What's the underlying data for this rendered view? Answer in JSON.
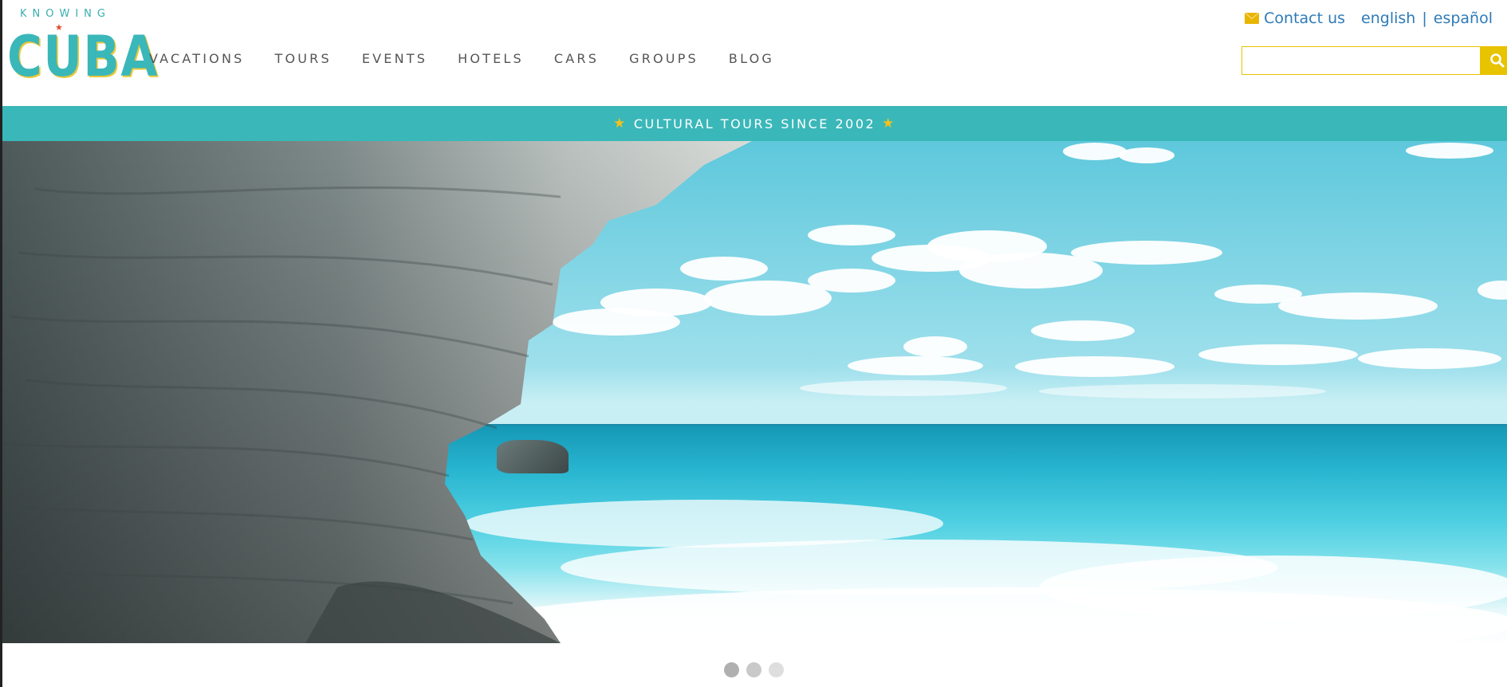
{
  "logo": {
    "top_text": "KNOWING",
    "main_text": "CUBA",
    "star": "★"
  },
  "nav": {
    "items": [
      "VACATIONS",
      "TOURS",
      "EVENTS",
      "HOTELS",
      "CARS",
      "GROUPS",
      "BLOG"
    ]
  },
  "top_links": {
    "contact": "Contact us",
    "lang_en": "english",
    "separator": "|",
    "lang_es": "español"
  },
  "search": {
    "placeholder": "",
    "value": ""
  },
  "banner": {
    "text": "CULTURAL TOURS SINCE 2002",
    "star": "★"
  },
  "carousel": {
    "slides": 3,
    "active": 1
  },
  "colors": {
    "teal": "#3ab7b9",
    "yellow": "#e8c300",
    "link_blue": "#2e7ab8",
    "nav_gray": "#555555"
  },
  "icons": {
    "mail": "envelope-icon",
    "search": "magnifier-icon"
  }
}
